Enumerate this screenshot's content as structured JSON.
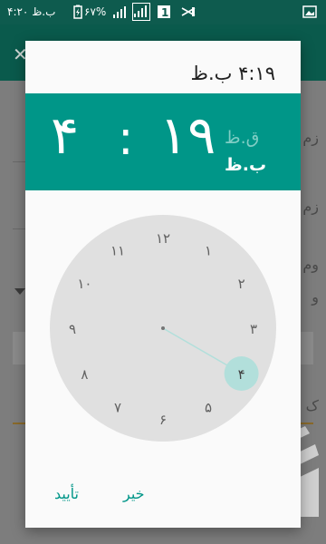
{
  "status_bar": {
    "time": "۴:۲۰ ب.ظ",
    "battery": "۶۷%",
    "icons": [
      "battery-charging-icon",
      "signal-icon",
      "signal-icon",
      "sim-1-icon",
      "no-signal-icon",
      "image-notification-icon"
    ]
  },
  "background": {
    "app_close_icon": "close-icon",
    "partial_texts": [
      "زم",
      "زم",
      "وم",
      "و",
      "ک"
    ]
  },
  "dialog": {
    "title": "۴:۱۹ ب.ظ",
    "hour": "۴",
    "colon": ":",
    "minute": "۱۹",
    "am_label": "ق.ظ",
    "pm_label": "ب.ظ",
    "selected_period": "pm",
    "clock_mode": "hour",
    "selected_hour": "۴",
    "clock_numbers": [
      "۱۲",
      "۱",
      "۲",
      "۳",
      "۴",
      "۵",
      "۶",
      "۷",
      "۸",
      "۹",
      "۱۰",
      "۱۱"
    ],
    "buttons": {
      "cancel": "خیر",
      "confirm": "تأیید"
    }
  },
  "colors": {
    "accent": "#009688",
    "status_bar": "#0e5b4e",
    "selector_circle": "#b2dfdb"
  }
}
